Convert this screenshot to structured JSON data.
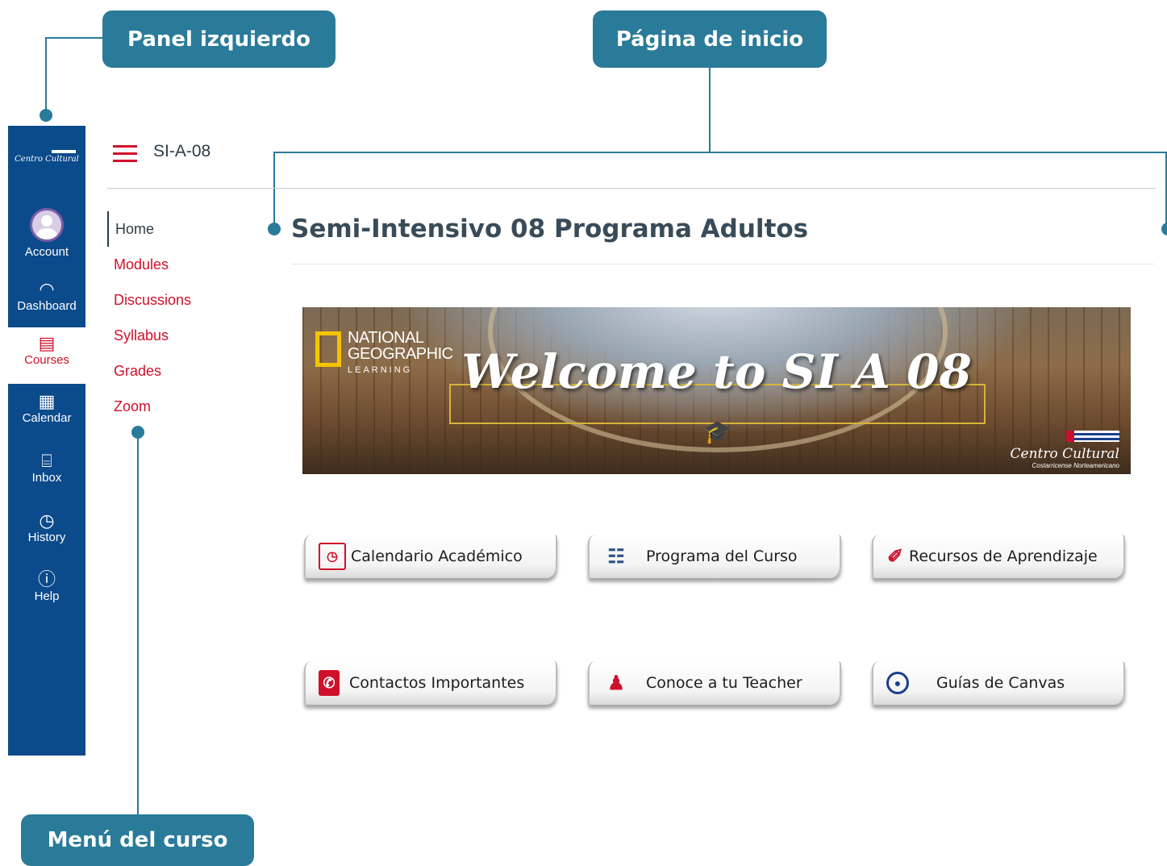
{
  "callouts": {
    "left_panel": "Panel izquierdo",
    "home_page": "Página de inicio",
    "course_menu": "Menú del curso"
  },
  "global_nav": {
    "logo_text": "Centro Cultural",
    "items": [
      {
        "label": "Account",
        "icon": "account-avatar"
      },
      {
        "label": "Dashboard",
        "icon": "dashboard-icon"
      },
      {
        "label": "Courses",
        "icon": "courses-icon"
      },
      {
        "label": "Calendar",
        "icon": "calendar-icon"
      },
      {
        "label": "Inbox",
        "icon": "inbox-icon"
      },
      {
        "label": "History",
        "icon": "history-icon"
      },
      {
        "label": "Help",
        "icon": "help-icon"
      }
    ],
    "active_color": "#d0102b",
    "background": "#0b4a8b"
  },
  "header": {
    "breadcrumb": "SI-A-08"
  },
  "course_menu": {
    "items": [
      {
        "label": "Home",
        "active": true
      },
      {
        "label": "Modules"
      },
      {
        "label": "Discussions"
      },
      {
        "label": "Syllabus"
      },
      {
        "label": "Grades"
      },
      {
        "label": "Zoom"
      }
    ]
  },
  "main": {
    "title": "Semi-Intensivo 08 Programa Adultos",
    "banner": {
      "brand_line1": "NATIONAL",
      "brand_line2": "GEOGRAPHIC",
      "brand_sub": "LEARNING",
      "welcome": "Welcome to SI A 08",
      "school": "Centro Cultural",
      "school_sub": "Costarricense Norteamericano"
    },
    "buttons": [
      {
        "label": "Calendario Académico",
        "icon": "calendar-icon"
      },
      {
        "label": "Programa del Curso",
        "icon": "clipboard-icon"
      },
      {
        "label": "Recursos de Aprendizaje",
        "icon": "paperclip-icon"
      },
      {
        "label": "Contactos Importantes",
        "icon": "phone-icon"
      },
      {
        "label": "Conoce a tu Teacher",
        "icon": "teacher-icon"
      },
      {
        "label": "Guías de Canvas",
        "icon": "search-guide-icon"
      }
    ]
  },
  "colors": {
    "accent": "#d0102b",
    "callout": "#2a7b99"
  }
}
